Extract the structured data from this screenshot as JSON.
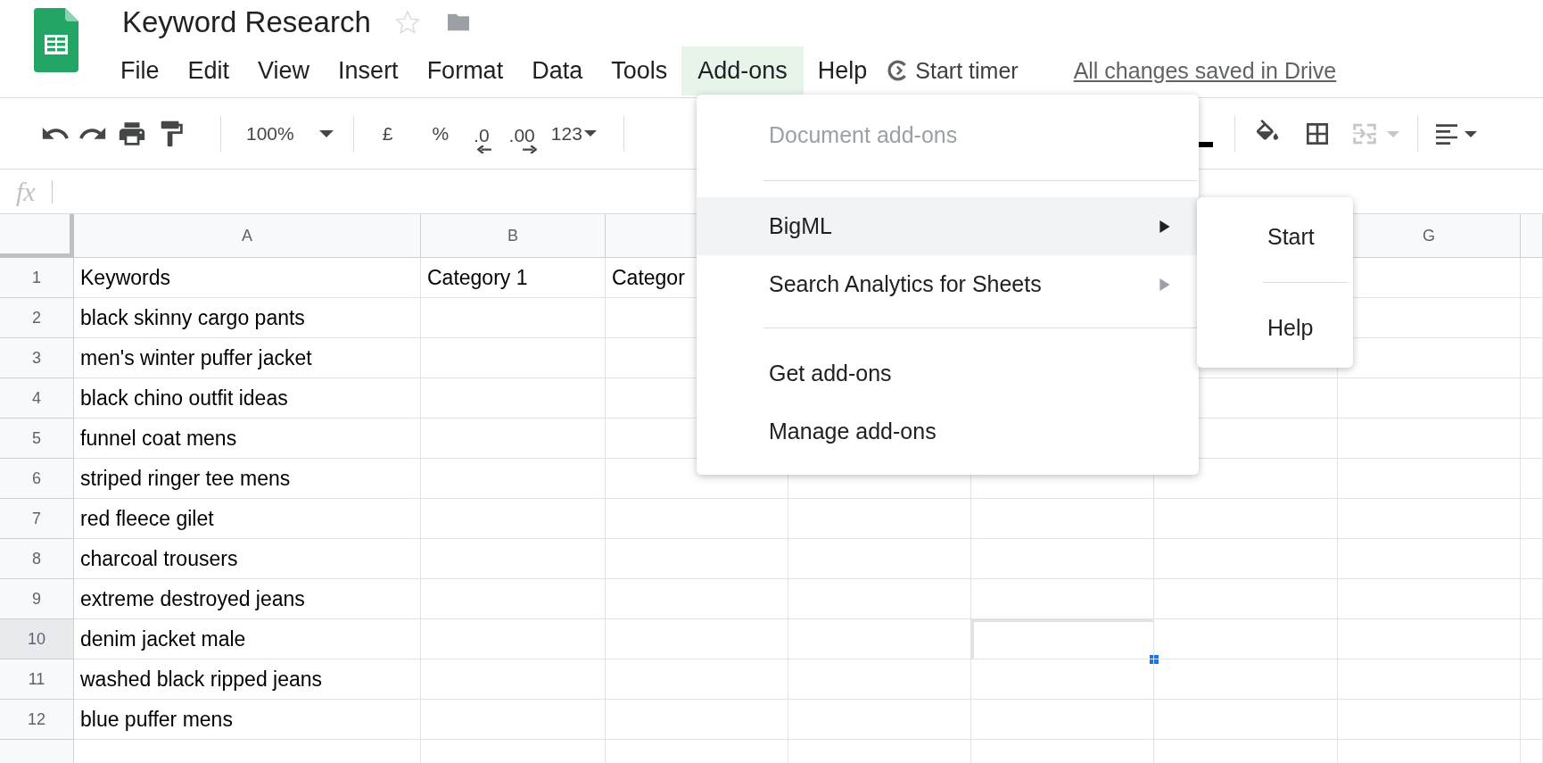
{
  "document": {
    "title": "Keyword Research",
    "starred": false
  },
  "menu_bar": [
    {
      "label": "File",
      "selected": false
    },
    {
      "label": "Edit",
      "selected": false
    },
    {
      "label": "View",
      "selected": false
    },
    {
      "label": "Insert",
      "selected": false
    },
    {
      "label": "Format",
      "selected": false
    },
    {
      "label": "Data",
      "selected": false
    },
    {
      "label": "Tools",
      "selected": false
    },
    {
      "label": "Add-ons",
      "selected": true
    },
    {
      "label": "Help",
      "selected": false
    }
  ],
  "timer": {
    "label": "Start timer"
  },
  "save_status": "All changes saved in Drive",
  "toolbar": {
    "zoom": "100%",
    "currency": "£",
    "percent": "%",
    "decrease_decimals": ".0",
    "increase_decimals": ".00",
    "number_format": "123"
  },
  "formula_bar": {
    "label": "fx"
  },
  "column_headers": [
    {
      "label": "A"
    },
    {
      "label": "B"
    },
    {
      "label": "G"
    }
  ],
  "rows": [
    {
      "number": "1",
      "selected": false,
      "cells": [
        "Keywords",
        "Category 1",
        "Categor"
      ]
    },
    {
      "number": "2",
      "selected": false,
      "cells": [
        "black skinny cargo pants"
      ]
    },
    {
      "number": "3",
      "selected": false,
      "cells": [
        "men's winter puffer jacket"
      ]
    },
    {
      "number": "4",
      "selected": false,
      "cells": [
        "black chino outfit ideas"
      ]
    },
    {
      "number": "5",
      "selected": false,
      "cells": [
        "funnel coat mens"
      ]
    },
    {
      "number": "6",
      "selected": false,
      "cells": [
        "striped ringer tee mens"
      ]
    },
    {
      "number": "7",
      "selected": false,
      "cells": [
        "red fleece gilet"
      ]
    },
    {
      "number": "8",
      "selected": false,
      "cells": [
        "charcoal trousers"
      ]
    },
    {
      "number": "9",
      "selected": false,
      "cells": [
        "extreme destroyed jeans"
      ]
    },
    {
      "number": "10",
      "selected": true,
      "cells": [
        "denim jacket male"
      ]
    },
    {
      "number": "11",
      "selected": false,
      "cells": [
        "washed black ripped jeans"
      ]
    },
    {
      "number": "12",
      "selected": false,
      "cells": [
        "blue puffer mens"
      ]
    }
  ],
  "addons_menu": [
    {
      "kind": "label",
      "label": "Document add-ons",
      "disabled": true
    },
    {
      "kind": "separator"
    },
    {
      "kind": "item",
      "label": "BigML",
      "has_submenu": true,
      "selected": true
    },
    {
      "kind": "item",
      "label": "Search Analytics for Sheets",
      "has_submenu": true,
      "selected": false
    },
    {
      "kind": "separator"
    },
    {
      "kind": "item",
      "label": "Get add-ons",
      "has_submenu": false,
      "selected": false
    },
    {
      "kind": "item",
      "label": "Manage add-ons",
      "has_submenu": false,
      "selected": false
    }
  ],
  "submenu": [
    {
      "kind": "item",
      "label": "Start"
    },
    {
      "kind": "separator"
    },
    {
      "kind": "item",
      "label": "Help"
    }
  ]
}
